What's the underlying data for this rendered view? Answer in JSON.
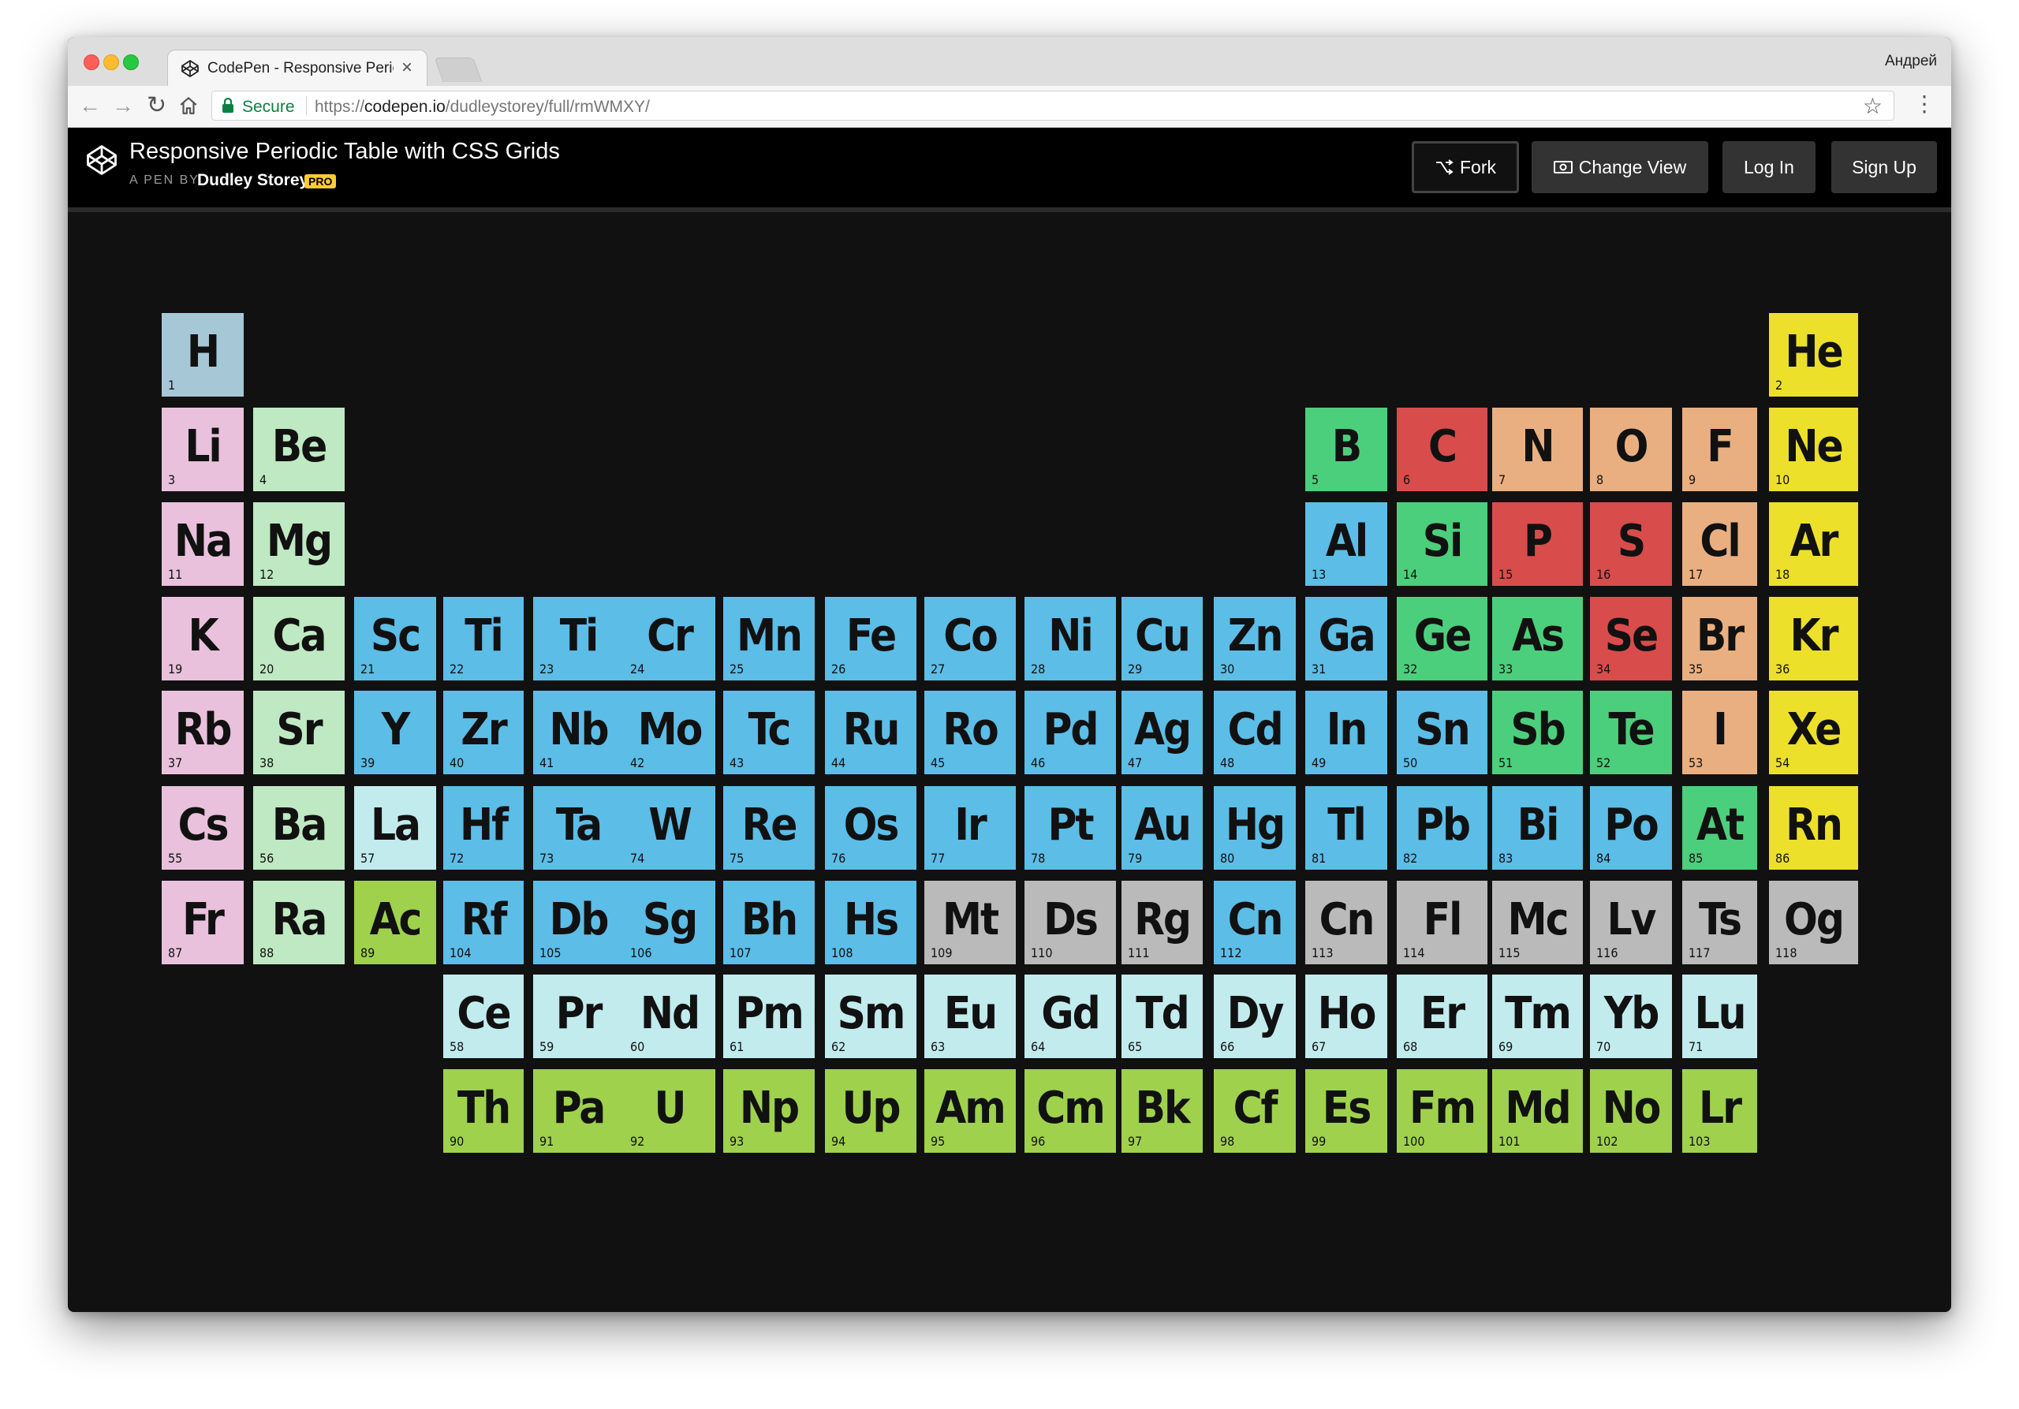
{
  "browser": {
    "tab_title": "CodePen - Responsive Periodic",
    "profile_name": "Андрей",
    "secure_label": "Secure",
    "url_scheme": "https://",
    "url_host": "codepen.io",
    "url_path": "/dudleystorey/full/rmWMXY/"
  },
  "header": {
    "pen_title": "Responsive Periodic Table with CSS Grids",
    "pen_by": "A PEN BY",
    "author": "Dudley Storey",
    "badge": "PRO",
    "buttons": {
      "fork": "Fork",
      "change_view": "Change View",
      "login": "Log In",
      "signup": "Sign Up"
    }
  },
  "colors": {
    "hydrogen": "#a6c8d6",
    "alkali": "#e9c1dc",
    "alkaline": "#bfe9c2",
    "transition": "#5cbde7",
    "lanthanide": "#c2ebee",
    "actinide": "#9fd14d",
    "metalloid": "#4ccf7c",
    "nonmetal": "#d94c4c",
    "halogen_group": "#eaaf80",
    "noble": "#ece02a",
    "unknown": "#bababa"
  },
  "elements": [
    {
      "sym": "H",
      "num": "1",
      "row": 1,
      "col": 1,
      "cat": "hydrogen"
    },
    {
      "sym": "He",
      "num": "2",
      "row": 1,
      "col": 18,
      "cat": "noble"
    },
    {
      "sym": "Li",
      "num": "3",
      "row": 2,
      "col": 1,
      "cat": "alkali"
    },
    {
      "sym": "Be",
      "num": "4",
      "row": 2,
      "col": 2,
      "cat": "alkaline"
    },
    {
      "sym": "B",
      "num": "5",
      "row": 2,
      "col": 13,
      "cat": "metalloid"
    },
    {
      "sym": "C",
      "num": "6",
      "row": 2,
      "col": 14,
      "cat": "nonmetal"
    },
    {
      "sym": "N",
      "num": "7",
      "row": 2,
      "col": 15,
      "cat": "halogen_group"
    },
    {
      "sym": "O",
      "num": "8",
      "row": 2,
      "col": 16,
      "cat": "halogen_group"
    },
    {
      "sym": "F",
      "num": "9",
      "row": 2,
      "col": 17,
      "cat": "halogen_group"
    },
    {
      "sym": "Ne",
      "num": "10",
      "row": 2,
      "col": 18,
      "cat": "noble"
    },
    {
      "sym": "Na",
      "num": "11",
      "row": 3,
      "col": 1,
      "cat": "alkali"
    },
    {
      "sym": "Mg",
      "num": "12",
      "row": 3,
      "col": 2,
      "cat": "alkaline"
    },
    {
      "sym": "Al",
      "num": "13",
      "row": 3,
      "col": 13,
      "cat": "transition"
    },
    {
      "sym": "Si",
      "num": "14",
      "row": 3,
      "col": 14,
      "cat": "metalloid"
    },
    {
      "sym": "P",
      "num": "15",
      "row": 3,
      "col": 15,
      "cat": "nonmetal"
    },
    {
      "sym": "S",
      "num": "16",
      "row": 3,
      "col": 16,
      "cat": "nonmetal"
    },
    {
      "sym": "Cl",
      "num": "17",
      "row": 3,
      "col": 17,
      "cat": "halogen_group"
    },
    {
      "sym": "Ar",
      "num": "18",
      "row": 3,
      "col": 18,
      "cat": "noble"
    },
    {
      "sym": "K",
      "num": "19",
      "row": 4,
      "col": 1,
      "cat": "alkali"
    },
    {
      "sym": "Ca",
      "num": "20",
      "row": 4,
      "col": 2,
      "cat": "alkaline"
    },
    {
      "sym": "Sc",
      "num": "21",
      "row": 4,
      "col": 3,
      "cat": "transition"
    },
    {
      "sym": "Ti",
      "num": "22",
      "row": 4,
      "col": 4,
      "cat": "transition"
    },
    {
      "sym": "Ti",
      "num": "23",
      "row": 4,
      "col": 5,
      "cat": "transition"
    },
    {
      "sym": "Cr",
      "num": "24",
      "row": 4,
      "col": 6,
      "cat": "transition"
    },
    {
      "sym": "Mn",
      "num": "25",
      "row": 4,
      "col": 7,
      "cat": "transition"
    },
    {
      "sym": "Fe",
      "num": "26",
      "row": 4,
      "col": 8,
      "cat": "transition"
    },
    {
      "sym": "Co",
      "num": "27",
      "row": 4,
      "col": 9,
      "cat": "transition"
    },
    {
      "sym": "Ni",
      "num": "28",
      "row": 4,
      "col": 10,
      "cat": "transition"
    },
    {
      "sym": "Cu",
      "num": "29",
      "row": 4,
      "col": 11,
      "cat": "transition"
    },
    {
      "sym": "Zn",
      "num": "30",
      "row": 4,
      "col": 12,
      "cat": "transition"
    },
    {
      "sym": "Ga",
      "num": "31",
      "row": 4,
      "col": 13,
      "cat": "transition"
    },
    {
      "sym": "Ge",
      "num": "32",
      "row": 4,
      "col": 14,
      "cat": "metalloid"
    },
    {
      "sym": "As",
      "num": "33",
      "row": 4,
      "col": 15,
      "cat": "metalloid"
    },
    {
      "sym": "Se",
      "num": "34",
      "row": 4,
      "col": 16,
      "cat": "nonmetal"
    },
    {
      "sym": "Br",
      "num": "35",
      "row": 4,
      "col": 17,
      "cat": "halogen_group"
    },
    {
      "sym": "Kr",
      "num": "36",
      "row": 4,
      "col": 18,
      "cat": "noble"
    },
    {
      "sym": "Rb",
      "num": "37",
      "row": 5,
      "col": 1,
      "cat": "alkali"
    },
    {
      "sym": "Sr",
      "num": "38",
      "row": 5,
      "col": 2,
      "cat": "alkaline"
    },
    {
      "sym": "Y",
      "num": "39",
      "row": 5,
      "col": 3,
      "cat": "transition"
    },
    {
      "sym": "Zr",
      "num": "40",
      "row": 5,
      "col": 4,
      "cat": "transition"
    },
    {
      "sym": "Nb",
      "num": "41",
      "row": 5,
      "col": 5,
      "cat": "transition"
    },
    {
      "sym": "Mo",
      "num": "42",
      "row": 5,
      "col": 6,
      "cat": "transition"
    },
    {
      "sym": "Tc",
      "num": "43",
      "row": 5,
      "col": 7,
      "cat": "transition"
    },
    {
      "sym": "Ru",
      "num": "44",
      "row": 5,
      "col": 8,
      "cat": "transition"
    },
    {
      "sym": "Ro",
      "num": "45",
      "row": 5,
      "col": 9,
      "cat": "transition"
    },
    {
      "sym": "Pd",
      "num": "46",
      "row": 5,
      "col": 10,
      "cat": "transition"
    },
    {
      "sym": "Ag",
      "num": "47",
      "row": 5,
      "col": 11,
      "cat": "transition"
    },
    {
      "sym": "Cd",
      "num": "48",
      "row": 5,
      "col": 12,
      "cat": "transition"
    },
    {
      "sym": "In",
      "num": "49",
      "row": 5,
      "col": 13,
      "cat": "transition"
    },
    {
      "sym": "Sn",
      "num": "50",
      "row": 5,
      "col": 14,
      "cat": "transition"
    },
    {
      "sym": "Sb",
      "num": "51",
      "row": 5,
      "col": 15,
      "cat": "metalloid"
    },
    {
      "sym": "Te",
      "num": "52",
      "row": 5,
      "col": 16,
      "cat": "metalloid"
    },
    {
      "sym": "I",
      "num": "53",
      "row": 5,
      "col": 17,
      "cat": "halogen_group"
    },
    {
      "sym": "Xe",
      "num": "54",
      "row": 5,
      "col": 18,
      "cat": "noble"
    },
    {
      "sym": "Cs",
      "num": "55",
      "row": 6,
      "col": 1,
      "cat": "alkali"
    },
    {
      "sym": "Ba",
      "num": "56",
      "row": 6,
      "col": 2,
      "cat": "alkaline"
    },
    {
      "sym": "La",
      "num": "57",
      "row": 6,
      "col": 3,
      "cat": "lanthanide"
    },
    {
      "sym": "Hf",
      "num": "72",
      "row": 6,
      "col": 4,
      "cat": "transition"
    },
    {
      "sym": "Ta",
      "num": "73",
      "row": 6,
      "col": 5,
      "cat": "transition"
    },
    {
      "sym": "W",
      "num": "74",
      "row": 6,
      "col": 6,
      "cat": "transition"
    },
    {
      "sym": "Re",
      "num": "75",
      "row": 6,
      "col": 7,
      "cat": "transition"
    },
    {
      "sym": "Os",
      "num": "76",
      "row": 6,
      "col": 8,
      "cat": "transition"
    },
    {
      "sym": "Ir",
      "num": "77",
      "row": 6,
      "col": 9,
      "cat": "transition"
    },
    {
      "sym": "Pt",
      "num": "78",
      "row": 6,
      "col": 10,
      "cat": "transition"
    },
    {
      "sym": "Au",
      "num": "79",
      "row": 6,
      "col": 11,
      "cat": "transition"
    },
    {
      "sym": "Hg",
      "num": "80",
      "row": 6,
      "col": 12,
      "cat": "transition"
    },
    {
      "sym": "Tl",
      "num": "81",
      "row": 6,
      "col": 13,
      "cat": "transition"
    },
    {
      "sym": "Pb",
      "num": "82",
      "row": 6,
      "col": 14,
      "cat": "transition"
    },
    {
      "sym": "Bi",
      "num": "83",
      "row": 6,
      "col": 15,
      "cat": "transition"
    },
    {
      "sym": "Po",
      "num": "84",
      "row": 6,
      "col": 16,
      "cat": "transition"
    },
    {
      "sym": "At",
      "num": "85",
      "row": 6,
      "col": 17,
      "cat": "metalloid"
    },
    {
      "sym": "Rn",
      "num": "86",
      "row": 6,
      "col": 18,
      "cat": "noble"
    },
    {
      "sym": "Fr",
      "num": "87",
      "row": 7,
      "col": 1,
      "cat": "alkali"
    },
    {
      "sym": "Ra",
      "num": "88",
      "row": 7,
      "col": 2,
      "cat": "alkaline"
    },
    {
      "sym": "Ac",
      "num": "89",
      "row": 7,
      "col": 3,
      "cat": "actinide"
    },
    {
      "sym": "Rf",
      "num": "104",
      "row": 7,
      "col": 4,
      "cat": "transition"
    },
    {
      "sym": "Db",
      "num": "105",
      "row": 7,
      "col": 5,
      "cat": "transition"
    },
    {
      "sym": "Sg",
      "num": "106",
      "row": 7,
      "col": 6,
      "cat": "transition"
    },
    {
      "sym": "Bh",
      "num": "107",
      "row": 7,
      "col": 7,
      "cat": "transition"
    },
    {
      "sym": "Hs",
      "num": "108",
      "row": 7,
      "col": 8,
      "cat": "transition"
    },
    {
      "sym": "Mt",
      "num": "109",
      "row": 7,
      "col": 9,
      "cat": "unknown"
    },
    {
      "sym": "Ds",
      "num": "110",
      "row": 7,
      "col": 10,
      "cat": "unknown"
    },
    {
      "sym": "Rg",
      "num": "111",
      "row": 7,
      "col": 11,
      "cat": "unknown"
    },
    {
      "sym": "Cn",
      "num": "112",
      "row": 7,
      "col": 12,
      "cat": "transition"
    },
    {
      "sym": "Cn",
      "num": "113",
      "row": 7,
      "col": 13,
      "cat": "unknown"
    },
    {
      "sym": "Fl",
      "num": "114",
      "row": 7,
      "col": 14,
      "cat": "unknown"
    },
    {
      "sym": "Mc",
      "num": "115",
      "row": 7,
      "col": 15,
      "cat": "unknown"
    },
    {
      "sym": "Lv",
      "num": "116",
      "row": 7,
      "col": 16,
      "cat": "unknown"
    },
    {
      "sym": "Ts",
      "num": "117",
      "row": 7,
      "col": 17,
      "cat": "unknown"
    },
    {
      "sym": "Og",
      "num": "118",
      "row": 7,
      "col": 18,
      "cat": "unknown"
    },
    {
      "sym": "Ce",
      "num": "58",
      "row": 8,
      "col": 4,
      "cat": "lanthanide"
    },
    {
      "sym": "Pr",
      "num": "59",
      "row": 8,
      "col": 5,
      "cat": "lanthanide"
    },
    {
      "sym": "Nd",
      "num": "60",
      "row": 8,
      "col": 6,
      "cat": "lanthanide"
    },
    {
      "sym": "Pm",
      "num": "61",
      "row": 8,
      "col": 7,
      "cat": "lanthanide"
    },
    {
      "sym": "Sm",
      "num": "62",
      "row": 8,
      "col": 8,
      "cat": "lanthanide"
    },
    {
      "sym": "Eu",
      "num": "63",
      "row": 8,
      "col": 9,
      "cat": "lanthanide"
    },
    {
      "sym": "Gd",
      "num": "64",
      "row": 8,
      "col": 10,
      "cat": "lanthanide"
    },
    {
      "sym": "Td",
      "num": "65",
      "row": 8,
      "col": 11,
      "cat": "lanthanide"
    },
    {
      "sym": "Dy",
      "num": "66",
      "row": 8,
      "col": 12,
      "cat": "lanthanide"
    },
    {
      "sym": "Ho",
      "num": "67",
      "row": 8,
      "col": 13,
      "cat": "lanthanide"
    },
    {
      "sym": "Er",
      "num": "68",
      "row": 8,
      "col": 14,
      "cat": "lanthanide"
    },
    {
      "sym": "Tm",
      "num": "69",
      "row": 8,
      "col": 15,
      "cat": "lanthanide"
    },
    {
      "sym": "Yb",
      "num": "70",
      "row": 8,
      "col": 16,
      "cat": "lanthanide"
    },
    {
      "sym": "Lu",
      "num": "71",
      "row": 8,
      "col": 17,
      "cat": "lanthanide"
    },
    {
      "sym": "Th",
      "num": "90",
      "row": 9,
      "col": 4,
      "cat": "actinide"
    },
    {
      "sym": "Pa",
      "num": "91",
      "row": 9,
      "col": 5,
      "cat": "actinide"
    },
    {
      "sym": "U",
      "num": "92",
      "row": 9,
      "col": 6,
      "cat": "actinide"
    },
    {
      "sym": "Np",
      "num": "93",
      "row": 9,
      "col": 7,
      "cat": "actinide"
    },
    {
      "sym": "Up",
      "num": "94",
      "row": 9,
      "col": 8,
      "cat": "actinide"
    },
    {
      "sym": "Am",
      "num": "95",
      "row": 9,
      "col": 9,
      "cat": "actinide"
    },
    {
      "sym": "Cm",
      "num": "96",
      "row": 9,
      "col": 10,
      "cat": "actinide"
    },
    {
      "sym": "Bk",
      "num": "97",
      "row": 9,
      "col": 11,
      "cat": "actinide"
    },
    {
      "sym": "Cf",
      "num": "98",
      "row": 9,
      "col": 12,
      "cat": "actinide"
    },
    {
      "sym": "Es",
      "num": "99",
      "row": 9,
      "col": 13,
      "cat": "actinide"
    },
    {
      "sym": "Fm",
      "num": "100",
      "row": 9,
      "col": 14,
      "cat": "actinide"
    },
    {
      "sym": "Md",
      "num": "101",
      "row": 9,
      "col": 15,
      "cat": "actinide"
    },
    {
      "sym": "No",
      "num": "102",
      "row": 9,
      "col": 16,
      "cat": "actinide"
    },
    {
      "sym": "Lr",
      "num": "103",
      "row": 9,
      "col": 17,
      "cat": "actinide"
    }
  ]
}
